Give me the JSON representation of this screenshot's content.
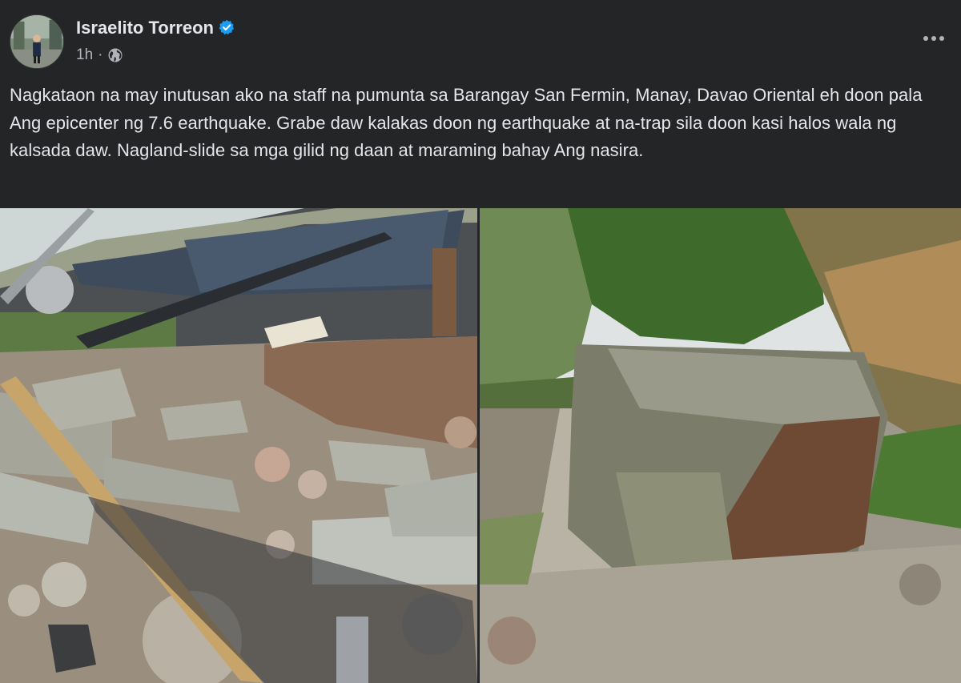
{
  "post": {
    "author": "Israelito Torreon",
    "time": "1h",
    "separator": "·",
    "text": "Nagkataon na may inutusan ako na staff na pumunta sa Barangay San Fermin, Manay, Davao Oriental eh doon pala Ang epicenter ng 7.6 earthquake. Grabe daw kalakas doon ng earthquake at na-trap sila doon kasi halos wala ng kalsada daw. Nagland-slide sa mga gilid ng daan at maraming bahay Ang nasira."
  },
  "icons": {
    "verified": "verified-badge-icon",
    "audience": "globe-icon",
    "more": "more-options-icon"
  },
  "colors": {
    "background": "#242526",
    "text_primary": "#e4e6eb",
    "text_secondary": "#b0b3b8",
    "verified_blue": "#1d9bf0"
  }
}
